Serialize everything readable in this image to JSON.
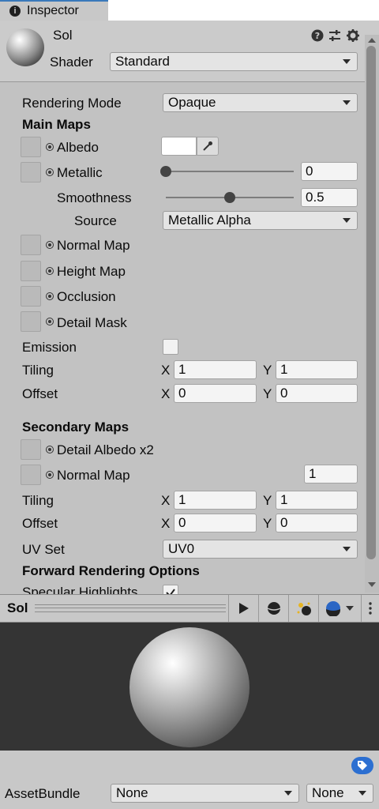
{
  "tab": {
    "title": "Inspector"
  },
  "material": {
    "name": "Sol",
    "shader_label": "Shader",
    "shader_value": "Standard"
  },
  "rendering_mode": {
    "label": "Rendering Mode",
    "value": "Opaque"
  },
  "main_maps": {
    "heading": "Main Maps",
    "albedo_label": "Albedo",
    "albedo_color": "#ffffff",
    "metallic_label": "Metallic",
    "metallic_value": "0",
    "metallic_fraction": 0.0,
    "smoothness_label": "Smoothness",
    "smoothness_value": "0.5",
    "smoothness_fraction": 0.5,
    "source_label": "Source",
    "source_value": "Metallic Alpha",
    "normal_map_label": "Normal Map",
    "height_map_label": "Height Map",
    "occlusion_label": "Occlusion",
    "detail_mask_label": "Detail Mask",
    "emission_label": "Emission",
    "tiling_label": "Tiling",
    "tiling_x": "1",
    "tiling_y": "1",
    "offset_label": "Offset",
    "offset_x": "0",
    "offset_y": "0",
    "x_label": "X",
    "y_label": "Y"
  },
  "secondary_maps": {
    "heading": "Secondary Maps",
    "detail_albedo_label": "Detail Albedo x2",
    "normal_map_label": "Normal Map",
    "normal_scale": "1",
    "tiling_label": "Tiling",
    "tiling_x": "1",
    "tiling_y": "1",
    "offset_label": "Offset",
    "offset_x": "0",
    "offset_y": "0",
    "uv_set_label": "UV Set",
    "uv_set_value": "UV0"
  },
  "forward_rendering": {
    "heading": "Forward Rendering Options",
    "specular_label": "Specular Highlights",
    "specular_checked": true
  },
  "preview": {
    "title": "Sol"
  },
  "asset_bundle": {
    "label": "AssetBundle",
    "name_value": "None",
    "variant_value": "None"
  },
  "colors": {
    "accent": "#3a79bb",
    "preview_bg": "#343434",
    "panel": "#c2c2c2"
  },
  "icons": [
    "info-icon",
    "help-icon",
    "sliders-icon",
    "gear-icon",
    "eyedropper-icon",
    "play-icon",
    "sphere-shape-icon",
    "light-icon",
    "material-ball-icon",
    "kebab-icon",
    "tag-icon"
  ]
}
